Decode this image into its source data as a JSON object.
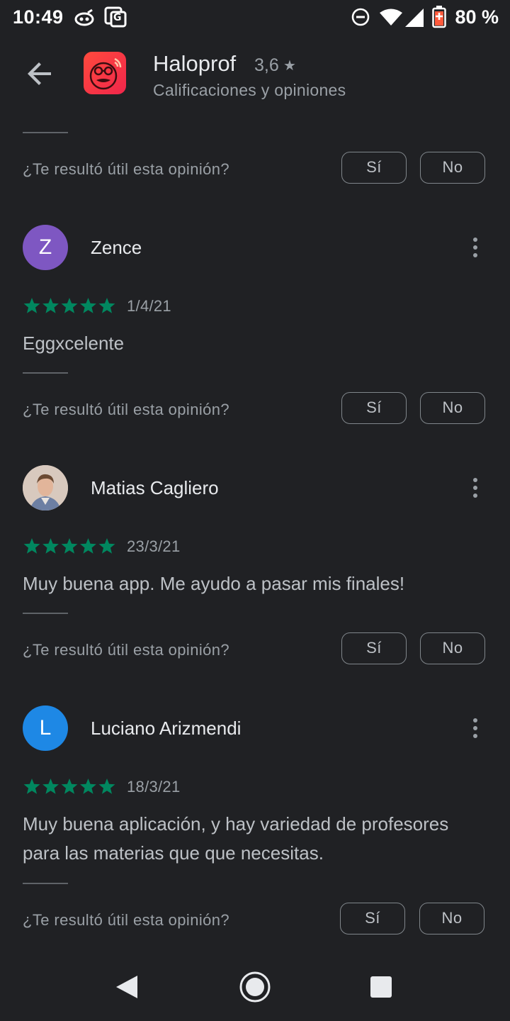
{
  "status": {
    "time": "10:49",
    "battery": "80 %"
  },
  "app": {
    "name": "Haloprof",
    "rating": "3,6",
    "rating_star": "★",
    "subtitle": "Calificaciones y opiniones"
  },
  "helpful_question": "¿Te resultó útil esta opinión?",
  "yes_label": "Sí",
  "no_label": "No",
  "reviews": [
    {
      "initial": "Z",
      "avatar_color": "#7e57c2",
      "name": "Zence",
      "date": "1/4/21",
      "text": "Eggxcelente",
      "rating": 5
    },
    {
      "initial": "",
      "avatar_color": "#c9b4a6",
      "name": "Matias Cagliero",
      "date": "23/3/21",
      "text": "Muy buena app. Me ayudo a pasar mis finales!",
      "rating": 5
    },
    {
      "initial": "L",
      "avatar_color": "#1e88e5",
      "name": "Luciano Arizmendi",
      "date": "18/3/21",
      "text": "Muy buena aplicación, y hay variedad de profesores para las materias que que necesitas.",
      "rating": 5
    }
  ],
  "colors": {
    "star": "#01875f",
    "background": "#202124"
  }
}
